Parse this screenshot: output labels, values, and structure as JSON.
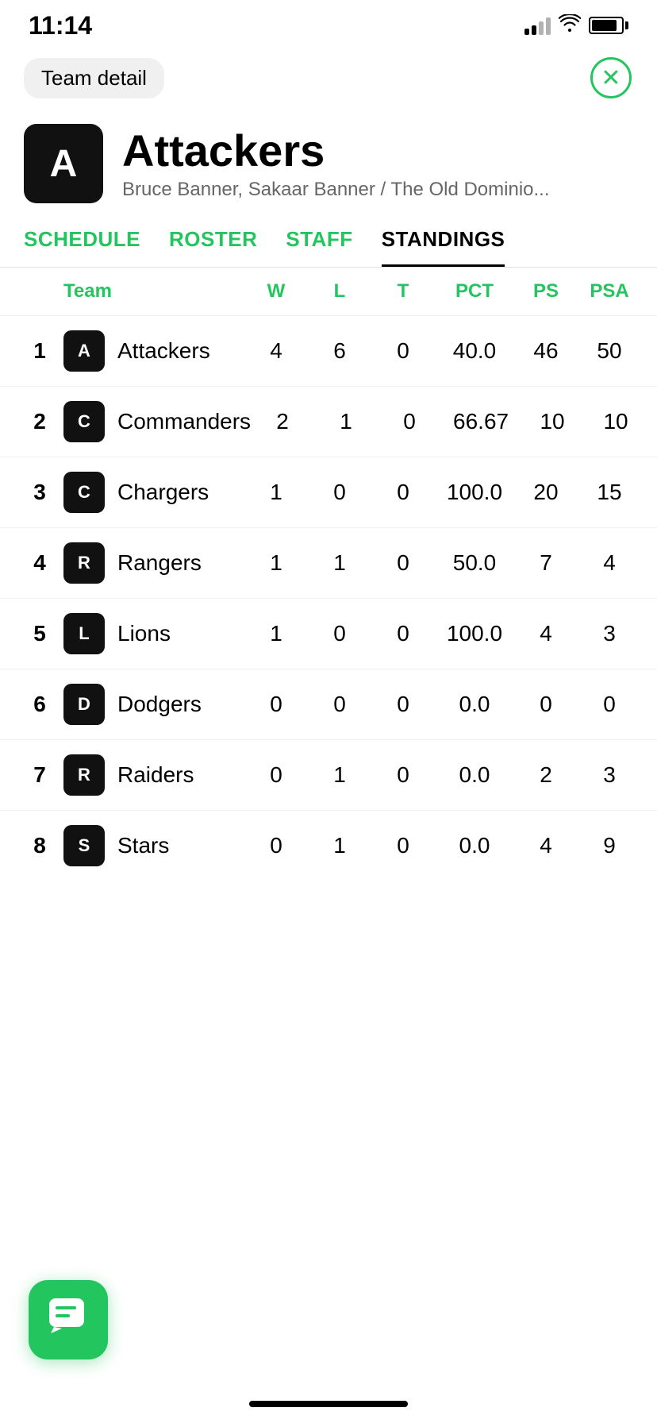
{
  "status": {
    "time": "11:14"
  },
  "header": {
    "back_label": "Team detail",
    "close_icon": "✕"
  },
  "team": {
    "avatar_letter": "A",
    "name": "Attackers",
    "subtitle": "Bruce Banner, Sakaar Banner / The Old Dominio..."
  },
  "tabs": [
    {
      "id": "schedule",
      "label": "SCHEDULE",
      "active": false
    },
    {
      "id": "roster",
      "label": "ROSTER",
      "active": false
    },
    {
      "id": "staff",
      "label": "STAFF",
      "active": false
    },
    {
      "id": "standings",
      "label": "STANDINGS",
      "active": true
    }
  ],
  "standings": {
    "columns": {
      "rank": "",
      "team": "Team",
      "w": "W",
      "l": "L",
      "t": "T",
      "pct": "PCT",
      "ps": "PS",
      "psa": "PSA"
    },
    "rows": [
      {
        "rank": "1",
        "letter": "A",
        "name": "Attackers",
        "w": "4",
        "l": "6",
        "t": "0",
        "pct": "40.0",
        "ps": "46",
        "psa": "50"
      },
      {
        "rank": "2",
        "letter": "C",
        "name": "Commanders",
        "w": "2",
        "l": "1",
        "t": "0",
        "pct": "66.67",
        "ps": "10",
        "psa": "10"
      },
      {
        "rank": "3",
        "letter": "C",
        "name": "Chargers",
        "w": "1",
        "l": "0",
        "t": "0",
        "pct": "100.0",
        "ps": "20",
        "psa": "15"
      },
      {
        "rank": "4",
        "letter": "R",
        "name": "Rangers",
        "w": "1",
        "l": "1",
        "t": "0",
        "pct": "50.0",
        "ps": "7",
        "psa": "4"
      },
      {
        "rank": "5",
        "letter": "L",
        "name": "Lions",
        "w": "1",
        "l": "0",
        "t": "0",
        "pct": "100.0",
        "ps": "4",
        "psa": "3"
      },
      {
        "rank": "6",
        "letter": "D",
        "name": "Dodgers",
        "w": "0",
        "l": "0",
        "t": "0",
        "pct": "0.0",
        "ps": "0",
        "psa": "0"
      },
      {
        "rank": "7",
        "letter": "R",
        "name": "Raiders",
        "w": "0",
        "l": "1",
        "t": "0",
        "pct": "0.0",
        "ps": "2",
        "psa": "3"
      },
      {
        "rank": "8",
        "letter": "S",
        "name": "Stars",
        "w": "0",
        "l": "1",
        "t": "0",
        "pct": "0.0",
        "ps": "4",
        "psa": "9"
      }
    ]
  },
  "chat_icon": "💬",
  "colors": {
    "green": "#22c55e",
    "black": "#111111",
    "white": "#ffffff"
  }
}
